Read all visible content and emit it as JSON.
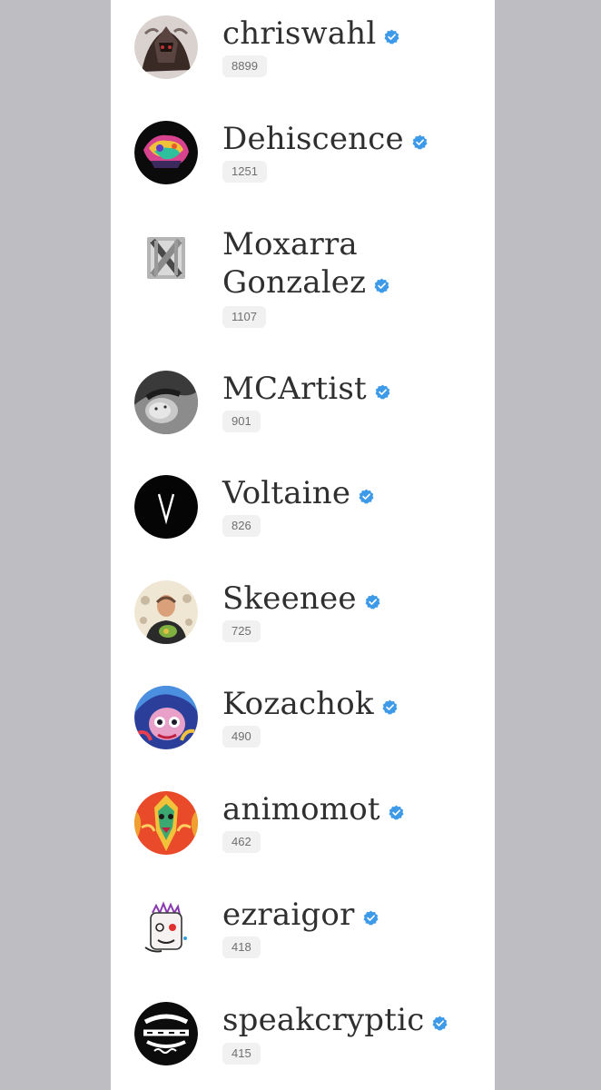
{
  "creators": [
    {
      "name": "chriswahl",
      "count": "8899",
      "avatar_icon": "warrior-portrait-avatar"
    },
    {
      "name": "Dehiscence",
      "count": "1251",
      "avatar_icon": "colorful-abstract-avatar"
    },
    {
      "name": "Moxarra Gonzalez",
      "name_lines": [
        "Moxarra",
        "Gonzalez"
      ],
      "count": "1107",
      "avatar_icon": "x-logo-avatar"
    },
    {
      "name": "MCArtist",
      "count": "901",
      "avatar_icon": "grayscale-portrait-avatar"
    },
    {
      "name": "Voltaine",
      "count": "826",
      "avatar_icon": "v-logo-avatar"
    },
    {
      "name": "Skeenee",
      "count": "725",
      "avatar_icon": "person-photo-avatar"
    },
    {
      "name": "Kozachok",
      "count": "490",
      "avatar_icon": "illustrated-face-avatar"
    },
    {
      "name": "animomot",
      "count": "462",
      "avatar_icon": "tribal-mask-avatar"
    },
    {
      "name": "ezraigor",
      "count": "418",
      "avatar_icon": "doodle-face-avatar"
    },
    {
      "name": "speakcryptic",
      "count": "415",
      "avatar_icon": "speakcryptic-logo-avatar"
    }
  ],
  "colors": {
    "side_gutter": "#bebdc2",
    "panel": "#ffffff",
    "name_text": "#2f2f2f",
    "verified_badge": "#3d9ae8",
    "count_pill_bg": "#f1f1f1",
    "count_pill_text": "#6f6f6f"
  },
  "icons": {
    "verified": "verified-check-icon"
  }
}
